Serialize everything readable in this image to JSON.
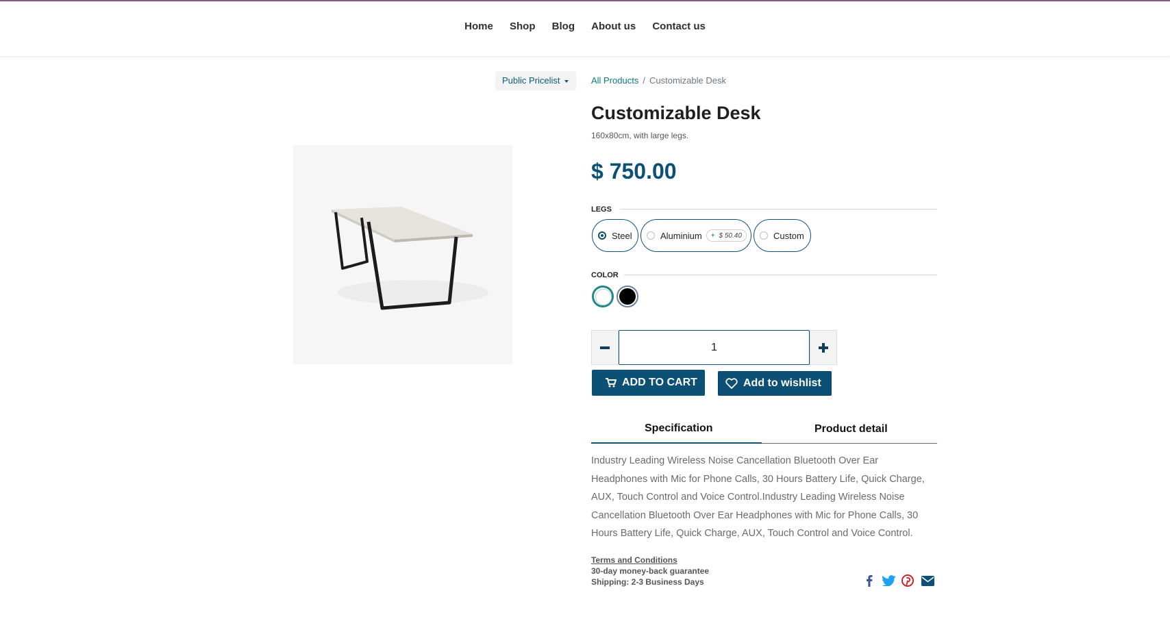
{
  "nav": {
    "items": [
      "Home",
      "Shop",
      "Blog",
      "About us",
      "Contact us"
    ]
  },
  "pricelist": {
    "label": "Public Pricelist"
  },
  "breadcrumb": {
    "root": "All Products",
    "separator": "/",
    "current": "Customizable Desk"
  },
  "product": {
    "name": "Customizable Desk",
    "description": "160x80cm, with large legs.",
    "price": "$ 750.00"
  },
  "attributes": {
    "legs": {
      "title": "LEGS",
      "options": [
        {
          "label": "Steel",
          "selected": true
        },
        {
          "label": "Aluminium",
          "extra": "$ 50.40",
          "extra_sign": "+",
          "selected": false
        },
        {
          "label": "Custom",
          "selected": false
        }
      ]
    },
    "color": {
      "title": "COLOR",
      "options": [
        {
          "name": "white",
          "hex": "#ffffff",
          "selected": true
        },
        {
          "name": "black",
          "hex": "#000000",
          "selected": false
        }
      ]
    }
  },
  "quantity": {
    "value": "1",
    "minus_icon": "minus-icon",
    "plus_icon": "plus-icon"
  },
  "buttons": {
    "add_to_cart": "ADD TO CART",
    "add_to_wishlist": "Add to wishlist"
  },
  "tabs": {
    "specification": "Specification",
    "product_detail": "Product detail"
  },
  "specification_text": "Industry Leading Wireless Noise Cancellation Bluetooth Over Ear Headphones with Mic for Phone Calls, 30 Hours Battery Life, Quick Charge, AUX, Touch Control and Voice Control.Industry Leading Wireless Noise Cancellation Bluetooth Over Ear Headphones with Mic for Phone Calls, 30 Hours Battery Life, Quick Charge, AUX, Touch Control and Voice Control.",
  "terms": {
    "link": "Terms and Conditions",
    "guarantee": "30-day money-back guarantee",
    "shipping": "Shipping: 2-3 Business Days"
  },
  "social": [
    "facebook-icon",
    "twitter-icon",
    "pinterest-icon",
    "email-icon"
  ],
  "colors": {
    "primary": "#0d5076",
    "accent_teal": "#0d7a7a",
    "top_rule": "#875a7b"
  }
}
